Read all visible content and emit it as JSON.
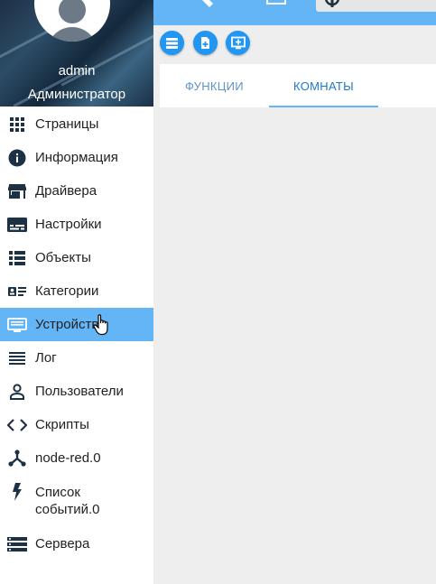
{
  "user": {
    "name": "admin",
    "role": "Администратор"
  },
  "sidebar": {
    "items": [
      {
        "label": "Страницы",
        "icon": "grid-icon"
      },
      {
        "label": "Информация",
        "icon": "info-icon"
      },
      {
        "label": "Драйвера",
        "icon": "store-icon"
      },
      {
        "label": "Настройки",
        "icon": "settings-card-icon"
      },
      {
        "label": "Объекты",
        "icon": "list-icon"
      },
      {
        "label": "Категории",
        "icon": "category-icon"
      },
      {
        "label": "Устройства",
        "icon": "devices-icon"
      },
      {
        "label": "Лог",
        "icon": "log-icon"
      },
      {
        "label": "Пользователи",
        "icon": "user-icon"
      },
      {
        "label": "Скрипты",
        "icon": "code-icon"
      },
      {
        "label": "node-red.0",
        "icon": "node-red-icon"
      },
      {
        "label": "Список\nсобытий.0",
        "icon": "bolt-icon"
      },
      {
        "label": "Сервера",
        "icon": "servers-icon"
      }
    ],
    "active_index": 6
  },
  "tabs": [
    {
      "label": "ФУНКЦИИ"
    },
    {
      "label": "КОМНАТЫ"
    }
  ],
  "selected_tab": 1,
  "colors": {
    "accent": "#64b5f6",
    "button": "#2196f3",
    "icon": "#1d3145"
  }
}
